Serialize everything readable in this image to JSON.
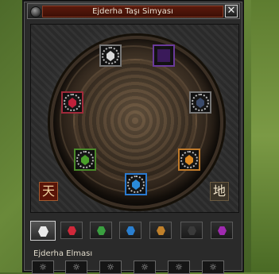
{
  "window": {
    "title": "Ejderha Taşı Simyası",
    "close_label": "✕"
  },
  "dial": {
    "slots": [
      {
        "id": "top",
        "gem_color": "#d8d8d8",
        "ornament": true
      },
      {
        "id": "top-right",
        "gem_color": "#3a1a5a",
        "ornament": false
      },
      {
        "id": "left",
        "gem_color": "#c0203a",
        "ornament": true
      },
      {
        "id": "right",
        "gem_color": "#3a4a6a",
        "ornament": true
      },
      {
        "id": "bottom-left",
        "gem_color": "#4aa02a",
        "ornament": true
      },
      {
        "id": "bottom-right",
        "gem_color": "#e08a20",
        "ornament": true
      },
      {
        "id": "bottom",
        "gem_color": "#2a8ad8",
        "ornament": true
      }
    ],
    "sky_glyph": "天",
    "earth_glyph": "地"
  },
  "tabs": [
    {
      "name": "diamond",
      "color": "#eaeaea",
      "active": true
    },
    {
      "name": "ruby",
      "color": "#d0283a",
      "active": false
    },
    {
      "name": "jade",
      "color": "#3aa040",
      "active": false
    },
    {
      "name": "sapphire",
      "color": "#2a7fd0",
      "active": false
    },
    {
      "name": "garnet",
      "color": "#c0802a",
      "active": false
    },
    {
      "name": "onyx",
      "color": "#3a3a3a",
      "active": false
    },
    {
      "name": "amethyst",
      "color": "#a02ab0",
      "active": false
    }
  ],
  "section": {
    "label": "Ejderha Elması"
  },
  "bottom_slots": [
    "☼",
    "☼",
    "☼",
    "☼",
    "☼",
    "☼"
  ]
}
